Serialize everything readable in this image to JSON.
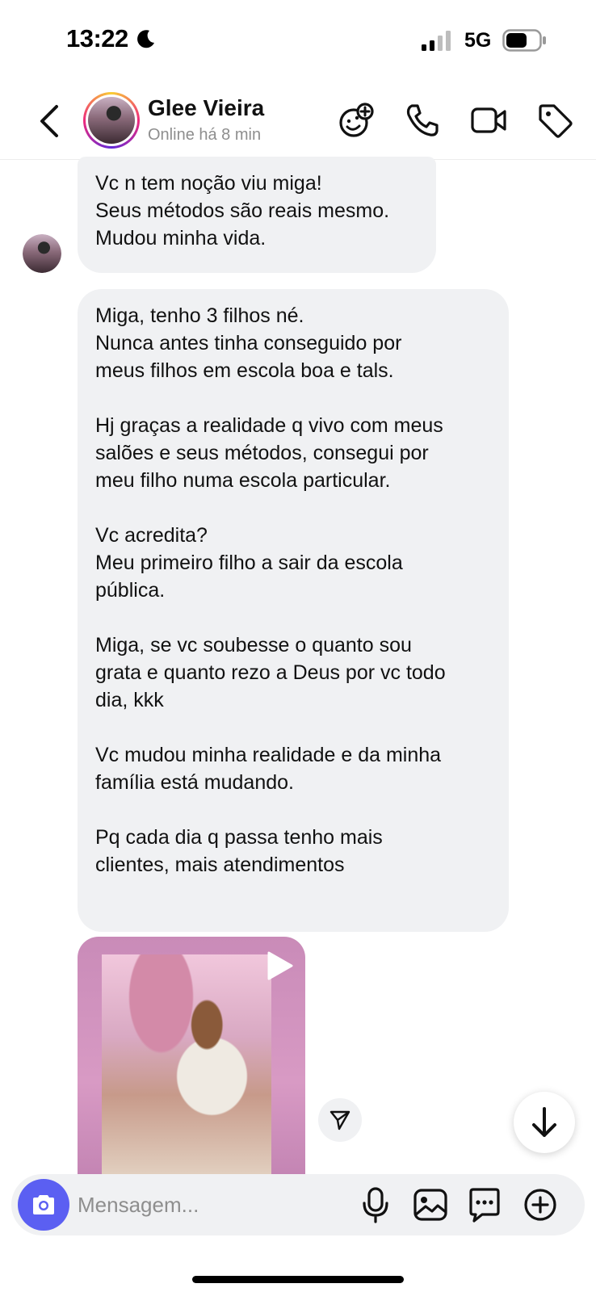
{
  "status_bar": {
    "time": "13:22",
    "network": "5G"
  },
  "header": {
    "contact_name": "Glee Vieira",
    "contact_status": "Online há 8 min"
  },
  "messages": {
    "bubble1": [
      "Vc n tem noção viu miga!",
      "Seus métodos são reais mesmo.",
      "Mudou minha vida."
    ],
    "bubble2": [
      [
        "Miga, tenho 3 filhos né.",
        "Nunca antes tinha conseguido por",
        "meus filhos em escola boa e tals."
      ],
      [
        "Hj graças a realidade q vivo com meus",
        "salões e seus métodos, consegui por",
        "meu filho numa escola particular."
      ],
      [
        "Vc acredita?",
        "Meu primeiro filho a sair da escola",
        "pública."
      ],
      [
        "Miga, se vc soubesse o quanto sou",
        "grata e quanto rezo a Deus por vc todo",
        "dia, kkk"
      ],
      [
        "Vc mudou minha realidade e da minha",
        "família está mudando."
      ],
      [
        "Pq cada dia q passa tenho mais",
        "clientes, mais atendimentos"
      ]
    ]
  },
  "composer": {
    "placeholder": "Mensagem..."
  },
  "icons": {
    "back": "chevron-left-icon",
    "effects": "face-plus-icon",
    "call": "phone-icon",
    "video": "video-camera-icon",
    "tag": "tag-icon",
    "camera": "camera-icon",
    "mic": "microphone-icon",
    "gallery": "image-icon",
    "sticker": "chat-sticker-icon",
    "more": "plus-circle-icon",
    "share": "send-icon",
    "scroll": "arrow-down-icon"
  },
  "colors": {
    "bubble": "#f0f1f3",
    "camera_button": "#5b5ff2",
    "secondary_text": "#8e8e8e"
  }
}
